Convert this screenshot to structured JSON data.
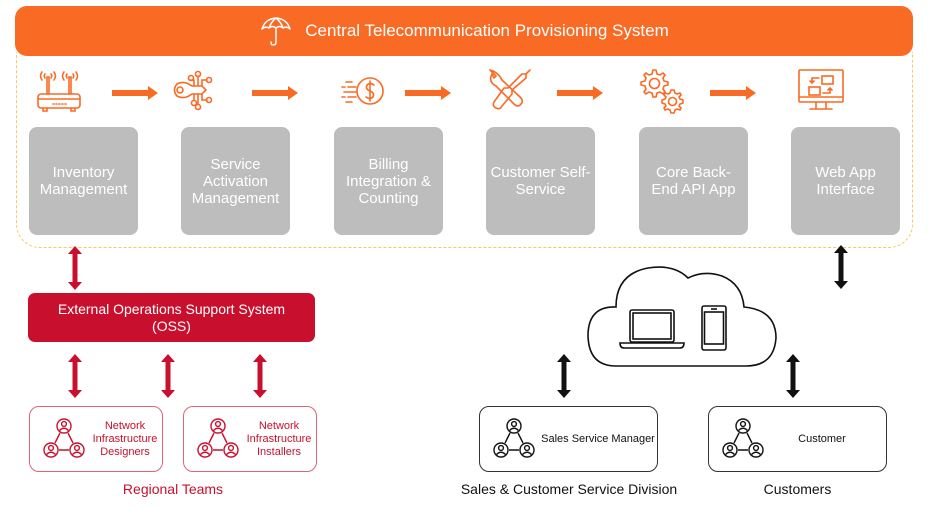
{
  "header": {
    "title": "Central Telecommunication Provisioning System",
    "icon": "umbrella-icon"
  },
  "modules": [
    {
      "label": "Inventory Management",
      "icon": "router-icon"
    },
    {
      "label": "Service Activation Management",
      "icon": "digital-key-icon"
    },
    {
      "label": "Billing Integration & Counting",
      "icon": "fast-dollar-icon"
    },
    {
      "label": "Customer Self-Service",
      "icon": "wrench-screwdriver-icon"
    },
    {
      "label": "Core Back-End API App",
      "icon": "gears-icon"
    },
    {
      "label": "Web App Interface",
      "icon": "monitor-workflow-icon"
    }
  ],
  "oss": {
    "label": "External Operations Support System (OSS)"
  },
  "teams": [
    {
      "label": "Network Infrastructure Designers",
      "group": "regional"
    },
    {
      "label": "Network Infrastructure Installers",
      "group": "regional"
    },
    {
      "label": "Sales Service Manager",
      "group": "sales"
    },
    {
      "label": "Customer",
      "group": "customers"
    }
  ],
  "groups": {
    "regional": "Regional Teams",
    "sales": "Sales & Customer Service Division",
    "customers": "Customers"
  },
  "cloud": {
    "icons": [
      "laptop-icon",
      "smartphone-icon"
    ]
  },
  "colors": {
    "orange": "#f96a24",
    "red": "#c8102e",
    "gray": "#bdbdbd",
    "dashed": "#f9c85e",
    "black": "#111111"
  }
}
